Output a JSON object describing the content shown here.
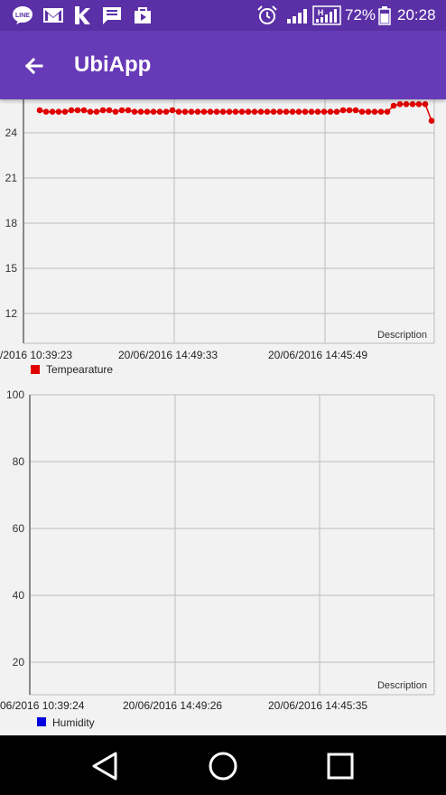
{
  "status_bar": {
    "battery_text": "72%",
    "time": "20:28",
    "signal_badge": "H",
    "left_icons": [
      "line-icon",
      "gmail-icon",
      "k-app-icon",
      "message-icon",
      "play-store-icon"
    ],
    "right_icons": [
      "alarm-icon",
      "signal-icon",
      "signal-h-icon",
      "battery-icon"
    ]
  },
  "app_bar": {
    "title": "UbiApp",
    "back_icon": "arrow-left-icon",
    "background": "#673ab7"
  },
  "chart_data": [
    {
      "type": "line",
      "x": [
        "/2016 10:39:23",
        "20/06/2016 14:49:33",
        "20/06/2016 14:45:49"
      ],
      "y_ticks": [
        "24",
        "21",
        "18",
        "15",
        "12"
      ],
      "ylim": [
        10.5,
        26
      ],
      "series": [
        {
          "name": "Tempearature",
          "color": "#e00000",
          "values": [
            25.5,
            25.4,
            25.4,
            25.4,
            25.4,
            25.5,
            25.5,
            25.5,
            25.4,
            25.4,
            25.5,
            25.5,
            25.4,
            25.5,
            25.5,
            25.4,
            25.4,
            25.4,
            25.4,
            25.4,
            25.4,
            25.5,
            25.4,
            25.4,
            25.4,
            25.4,
            25.4,
            25.4,
            25.4,
            25.4,
            25.4,
            25.4,
            25.4,
            25.4,
            25.4,
            25.4,
            25.4,
            25.4,
            25.4,
            25.4,
            25.4,
            25.4,
            25.4,
            25.4,
            25.4,
            25.4,
            25.4,
            25.4,
            25.5,
            25.5,
            25.5,
            25.4,
            25.4,
            25.4,
            25.4,
            25.4,
            25.8,
            25.9,
            25.9,
            25.9,
            25.9,
            25.9,
            24.8
          ],
          "point_x_step": 8.11
        }
      ],
      "description": "Description",
      "grid": true,
      "legend_position": "bottom-left"
    },
    {
      "type": "line",
      "x": [
        "06/2016 10:39:24",
        "20/06/2016 14:49:26",
        "20/06/2016 14:45:35"
      ],
      "y_ticks": [
        "100",
        "80",
        "60",
        "40",
        "20"
      ],
      "ylim": [
        10,
        100
      ],
      "series": [
        {
          "name": "Humidity",
          "color": "#0000e0",
          "values": []
        }
      ],
      "description": "Description",
      "grid": true,
      "legend_position": "bottom-left"
    }
  ],
  "nav_bar": {
    "buttons": [
      "back-triangle-icon",
      "home-circle-icon",
      "recents-square-icon"
    ]
  }
}
